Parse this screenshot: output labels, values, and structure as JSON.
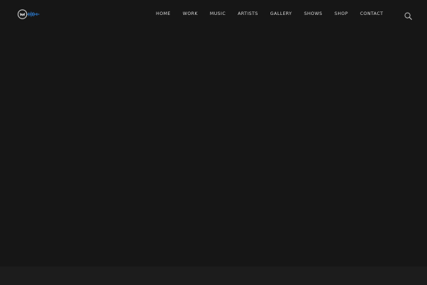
{
  "nav": {
    "items": [
      {
        "label": "HOME"
      },
      {
        "label": "WORK"
      },
      {
        "label": "MUSIC"
      },
      {
        "label": "ARTISTS"
      },
      {
        "label": "GALLERY"
      },
      {
        "label": "SHOWS"
      },
      {
        "label": "SHOP"
      },
      {
        "label": "CONTACT"
      }
    ]
  },
  "icons": {
    "logo": "logo-icon",
    "search": "search-icon"
  },
  "colors": {
    "background": "#161616",
    "footer_band": "#1c1c1c",
    "nav_text": "#d9d9d9",
    "logo_accent": "#2a76c7"
  }
}
